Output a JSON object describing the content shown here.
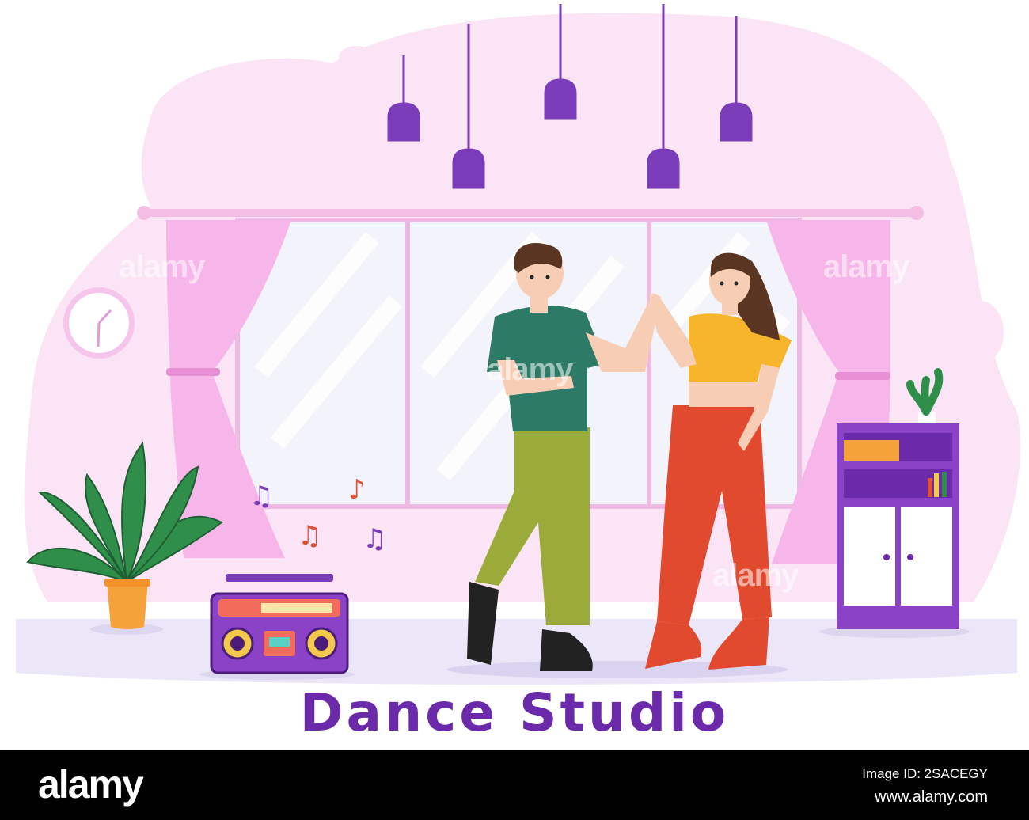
{
  "illustration": {
    "title": "Dance Studio",
    "colors": {
      "background_blob": "#fbe4f5",
      "floor": "#ebe7f8",
      "curtain": "#f7b6ea",
      "purple": "#7a3cb8",
      "title": "#6a2aa9"
    }
  },
  "watermark": {
    "overlay_text": "alamy",
    "logo": "alamy",
    "image_id": "Image ID: 2SACEGY",
    "url": "www.alamy.com"
  }
}
